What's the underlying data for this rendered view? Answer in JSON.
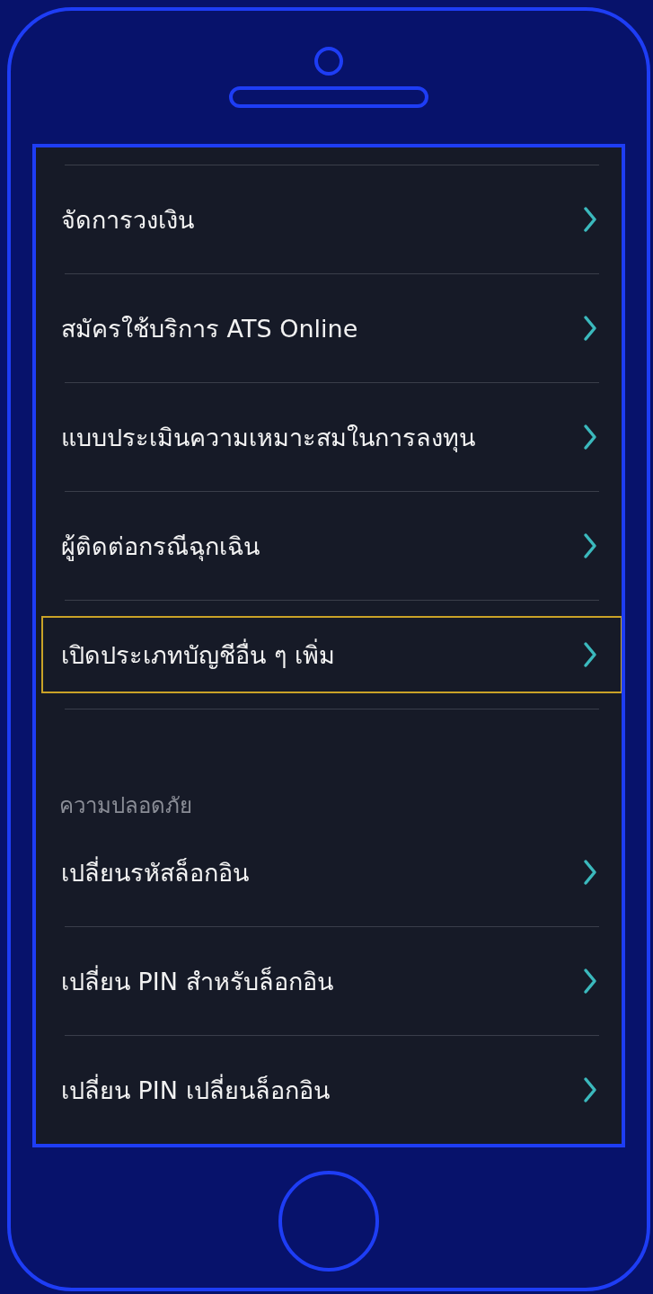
{
  "sections": [
    {
      "items": [
        {
          "label": "จัดการวงเงิน",
          "focused": false
        },
        {
          "label": "สมัครใช้บริการ ATS Online",
          "focused": false
        },
        {
          "label": "แบบประเมินความเหมาะสมในการลงทุน",
          "focused": false
        },
        {
          "label": "ผู้ติดต่อกรณีฉุกเฉิน",
          "focused": false
        },
        {
          "label": "เปิดประเภทบัญชีอื่น ๆ เพิ่ม",
          "focused": true
        }
      ]
    },
    {
      "header": "ความปลอดภัย",
      "items": [
        {
          "label": "เปลี่ยนรหัสล็อกอิน",
          "focused": false
        },
        {
          "label": "เปลี่ยน PIN สำหรับล็อกอิน",
          "focused": false
        },
        {
          "label": "เปลี่ยน PIN เปลี่ยนล็อกอิน",
          "focused": false
        }
      ]
    }
  ]
}
